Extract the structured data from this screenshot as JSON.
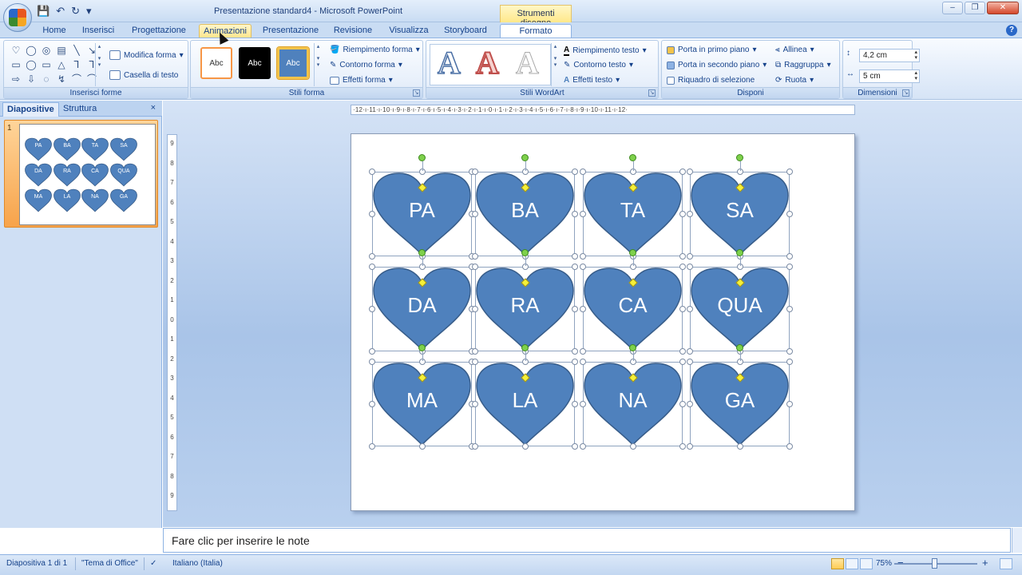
{
  "window": {
    "title": "Presentazione standard4 - Microsoft PowerPoint",
    "contextual_tab_group": "Strumenti disegno",
    "controls": [
      "–",
      "❐",
      "✕"
    ]
  },
  "qat": {
    "save": "💾",
    "undo": "↶",
    "redo": "↻",
    "more": "▾"
  },
  "tabs": [
    {
      "label": "Home",
      "state": "normal"
    },
    {
      "label": "Inserisci",
      "state": "normal"
    },
    {
      "label": "Progettazione",
      "state": "normal"
    },
    {
      "label": "Animazioni",
      "state": "hover"
    },
    {
      "label": "Presentazione",
      "state": "normal"
    },
    {
      "label": "Revisione",
      "state": "normal"
    },
    {
      "label": "Visualizza",
      "state": "normal"
    },
    {
      "label": "Storyboard",
      "state": "normal"
    },
    {
      "label": "Formato",
      "state": "active"
    }
  ],
  "ribbon": {
    "inserisci_forme": {
      "label": "Inserisci forme",
      "modifica_forma": "Modifica forma",
      "casella_testo": "Casella di testo",
      "shapes": [
        "♡",
        "◯",
        "◎",
        "▤",
        "╲",
        "↘",
        "▭",
        "◯",
        "▭",
        "△",
        "⅂",
        "⅂",
        "⇨",
        "⇩",
        "◌",
        "↯",
        "⌒",
        "⌒"
      ]
    },
    "stili_forma": {
      "label": "Stili forma",
      "presets": [
        "Abc",
        "Abc",
        "Abc"
      ],
      "riempimento": "Riempimento forma",
      "contorno": "Contorno forma",
      "effetti": "Effetti forma"
    },
    "stili_wordart": {
      "label": "Stili WordArt",
      "letters": [
        "A",
        "A",
        "A"
      ],
      "riempimento": "Riempimento testo",
      "contorno": "Contorno testo",
      "effetti": "Effetti testo"
    },
    "disponi": {
      "label": "Disponi",
      "primo_piano": "Porta in primo piano",
      "secondo_piano": "Porta in secondo piano",
      "riquadro": "Riquadro di selezione",
      "allinea": "Allinea",
      "raggruppa": "Raggruppa",
      "ruota": "Ruota"
    },
    "dimensioni": {
      "label": "Dimensioni",
      "height": "4,2 cm",
      "width": "5 cm"
    }
  },
  "left_pane": {
    "tab_slides": "Diapositive",
    "tab_outline": "Struttura",
    "close": "×",
    "slide_number": "1"
  },
  "ruler": {
    "horizontal": "·12·ı·11·ı·10·ı·9·ı·8·ı·7·ı·6·ı·5·ı·4·ı·3·ı·2·ı·1·ı·0·ı·1·ı·2·ı·3·ı·4·ı·5·ı·6·ı·7·ı·8·ı·9·ı·10·ı·11·ı·12·",
    "vertical": [
      "9",
      "8",
      "7",
      "6",
      "5",
      "4",
      "3",
      "2",
      "1",
      "0",
      "1",
      "2",
      "3",
      "4",
      "5",
      "6",
      "7",
      "8",
      "9"
    ]
  },
  "hearts": {
    "fill": "#4f81bd",
    "stroke": "#385d8a",
    "labels": [
      "PA",
      "BA",
      "TA",
      "SA",
      "DA",
      "RA",
      "CA",
      "QUA",
      "MA",
      "LA",
      "NA",
      "GA"
    ]
  },
  "notes_placeholder": "Fare clic per inserire le note",
  "status": {
    "slide": "Diapositiva 1 di 1",
    "theme": "\"Tema di Office\"",
    "language": "Italiano (Italia)",
    "zoom": "75%",
    "zoom_minus": "−",
    "zoom_plus": "+"
  }
}
